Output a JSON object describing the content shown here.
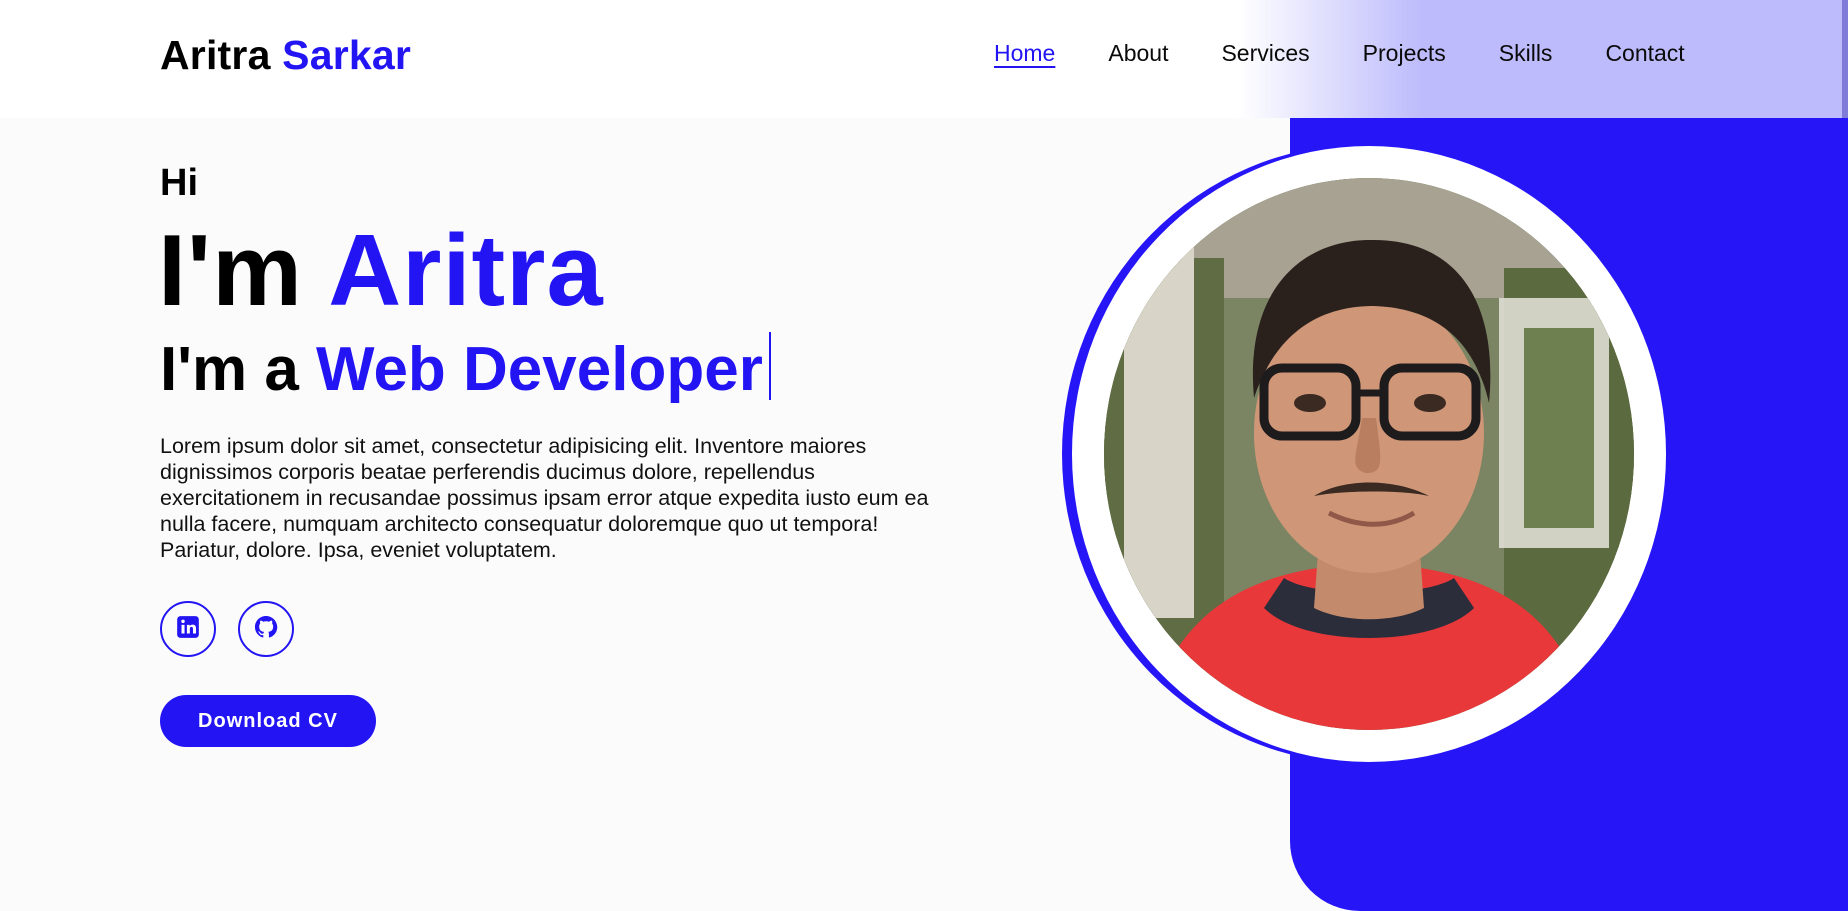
{
  "brand": {
    "first": "Aritra",
    "last": "Sarkar"
  },
  "nav": {
    "items": [
      "Home",
      "About",
      "Services",
      "Projects",
      "Skills",
      "Contact"
    ],
    "active": "Home"
  },
  "hero": {
    "greeting": "Hi",
    "intro_prefix": "I'm",
    "intro_name": "Aritra",
    "role_prefix": "I'm a",
    "role": "Web Developer",
    "description": "Lorem ipsum dolor sit amet, consectetur adipisicing elit. Inventore maiores dignissimos corporis beatae perferendis ducimus dolore, repellendus exercitationem in recusandae possimus ipsam error atque expedita iusto eum ea nulla facere, numquam architecto consequatur doloremque quo ut tempora! Pariatur, dolore. Ipsa, eveniet voluptatem."
  },
  "social": {
    "linkedin_icon": "linkedin-icon",
    "github_icon": "github-icon"
  },
  "cta": {
    "download_label": "Download CV"
  },
  "colors": {
    "accent": "#2315f3",
    "panel": "#2616f7",
    "header_tint": "#bdbbfb",
    "background": "#fcfbfc"
  }
}
